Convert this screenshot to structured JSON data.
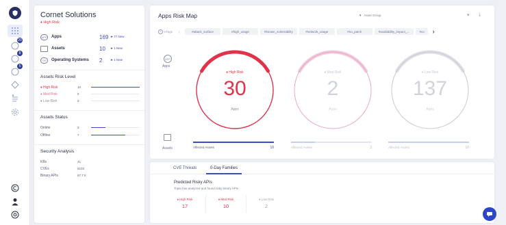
{
  "org": {
    "name": "Cornet Solutions",
    "risk": "♦ High Risk"
  },
  "assets": [
    {
      "icon": "app-icon",
      "name": "Apps",
      "count": "169",
      "new": "★ 77 New"
    },
    {
      "icon": "asset-icon",
      "name": "Assets",
      "count": "10",
      "new": "★ 1 New"
    },
    {
      "icon": "os-icon",
      "name": "Operating Systems",
      "count": "2",
      "new": "★ 1 New"
    }
  ],
  "risk_level": {
    "title": "Assets Risk Level",
    "rows": [
      {
        "label": "♦ High Risk",
        "count": "10",
        "fraction": 1.0
      },
      {
        "label": "♦ Med Risk",
        "count": "0",
        "fraction": 0.0
      },
      {
        "label": "♦ Low Risk",
        "count": "0",
        "fraction": 0.0
      }
    ]
  },
  "status": {
    "title": "Assets Status",
    "rows": [
      {
        "label": "Online",
        "count": "3",
        "fraction": 0.3
      },
      {
        "label": "Offline",
        "count": "7",
        "fraction": 0.7
      }
    ]
  },
  "security": {
    "title": "Security Analysis",
    "rows": [
      {
        "label": "KBs",
        "value": "41"
      },
      {
        "label": "CVEs",
        "value": "6103"
      },
      {
        "label": "Binary APIs",
        "value": "67.7 K"
      }
    ]
  },
  "main": {
    "title": "Apps Risk Map",
    "filter": "Asset Group",
    "tags_label": "eTags",
    "tags": [
      "#attack_surface",
      "#high_usage",
      "#known_vulnerability",
      "#network_usage",
      "#no_patch",
      "#availability_impact_...",
      "#co"
    ],
    "apps_label": "Apps",
    "assets_label": "Assets",
    "gauges": [
      {
        "label": "♦ High Risk",
        "value": "30",
        "sub": "Apps",
        "color": "#e0334a",
        "active": true
      },
      {
        "label": "♦ Med Risk",
        "value": "2",
        "sub": "Apps",
        "color": "#e8a9c4",
        "active": false
      },
      {
        "label": "♦ Low Risk",
        "value": "137",
        "sub": "Apps",
        "color": "#c9cad3",
        "active": false
      }
    ],
    "asset_bars": [
      {
        "label": "Affected Assets",
        "count": "10",
        "fraction": 1.0
      },
      {
        "label": "Affected Assets",
        "count": "3",
        "fraction": 0.3
      },
      {
        "label": "Affected Assets",
        "count": "10",
        "fraction": 1.0
      }
    ]
  },
  "bottom": {
    "tabs": [
      "CVE Threats",
      "0-Day Families"
    ],
    "active_tab": 1,
    "title": "Predicted Risky APIs",
    "subtitle": "Topia has analyzed and found risky binary APIs",
    "kpis": [
      {
        "label": "♦ High Risk",
        "value": "17",
        "color": "#e0334a"
      },
      {
        "label": "♦ Med Risk",
        "value": "10",
        "color": "#e0334a"
      },
      {
        "label": "♦ Low Risk",
        "value": "2",
        "color": "#a0a4ba"
      }
    ]
  },
  "rail": {
    "badges": [
      "20",
      "8",
      "5"
    ]
  }
}
